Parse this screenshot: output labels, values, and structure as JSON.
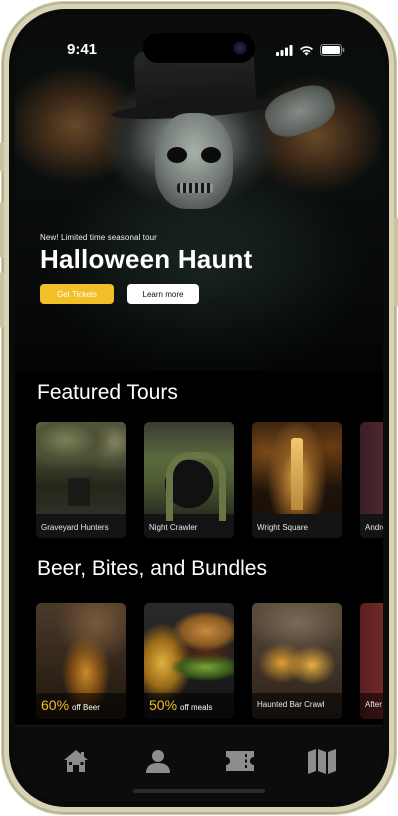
{
  "status_bar": {
    "time": "9:41"
  },
  "hero": {
    "eyebrow": "New! Limited time seasonal tour",
    "title": "Halloween Haunt",
    "primary_button": "Get Tickets",
    "secondary_button": "Learn more"
  },
  "featured": {
    "title": "Featured Tours",
    "tours": [
      {
        "label": "Graveyard Hunters"
      },
      {
        "label": "Night Crawler"
      },
      {
        "label": "Wright Square"
      },
      {
        "label": "Andre"
      }
    ]
  },
  "bundles": {
    "title": "Beer, Bites, and Bundles",
    "items": [
      {
        "percent": "60%",
        "text": "off Beer"
      },
      {
        "percent": "50%",
        "text": "off meals"
      },
      {
        "label": "Haunted Bar Crawl"
      },
      {
        "label": "After"
      }
    ]
  },
  "tab_bar": {
    "tabs": [
      {
        "icon": "home-icon"
      },
      {
        "icon": "profile-icon"
      },
      {
        "icon": "ticket-icon"
      },
      {
        "icon": "map-icon"
      }
    ]
  },
  "colors": {
    "accent": "#f3bf29",
    "background": "#000000"
  }
}
